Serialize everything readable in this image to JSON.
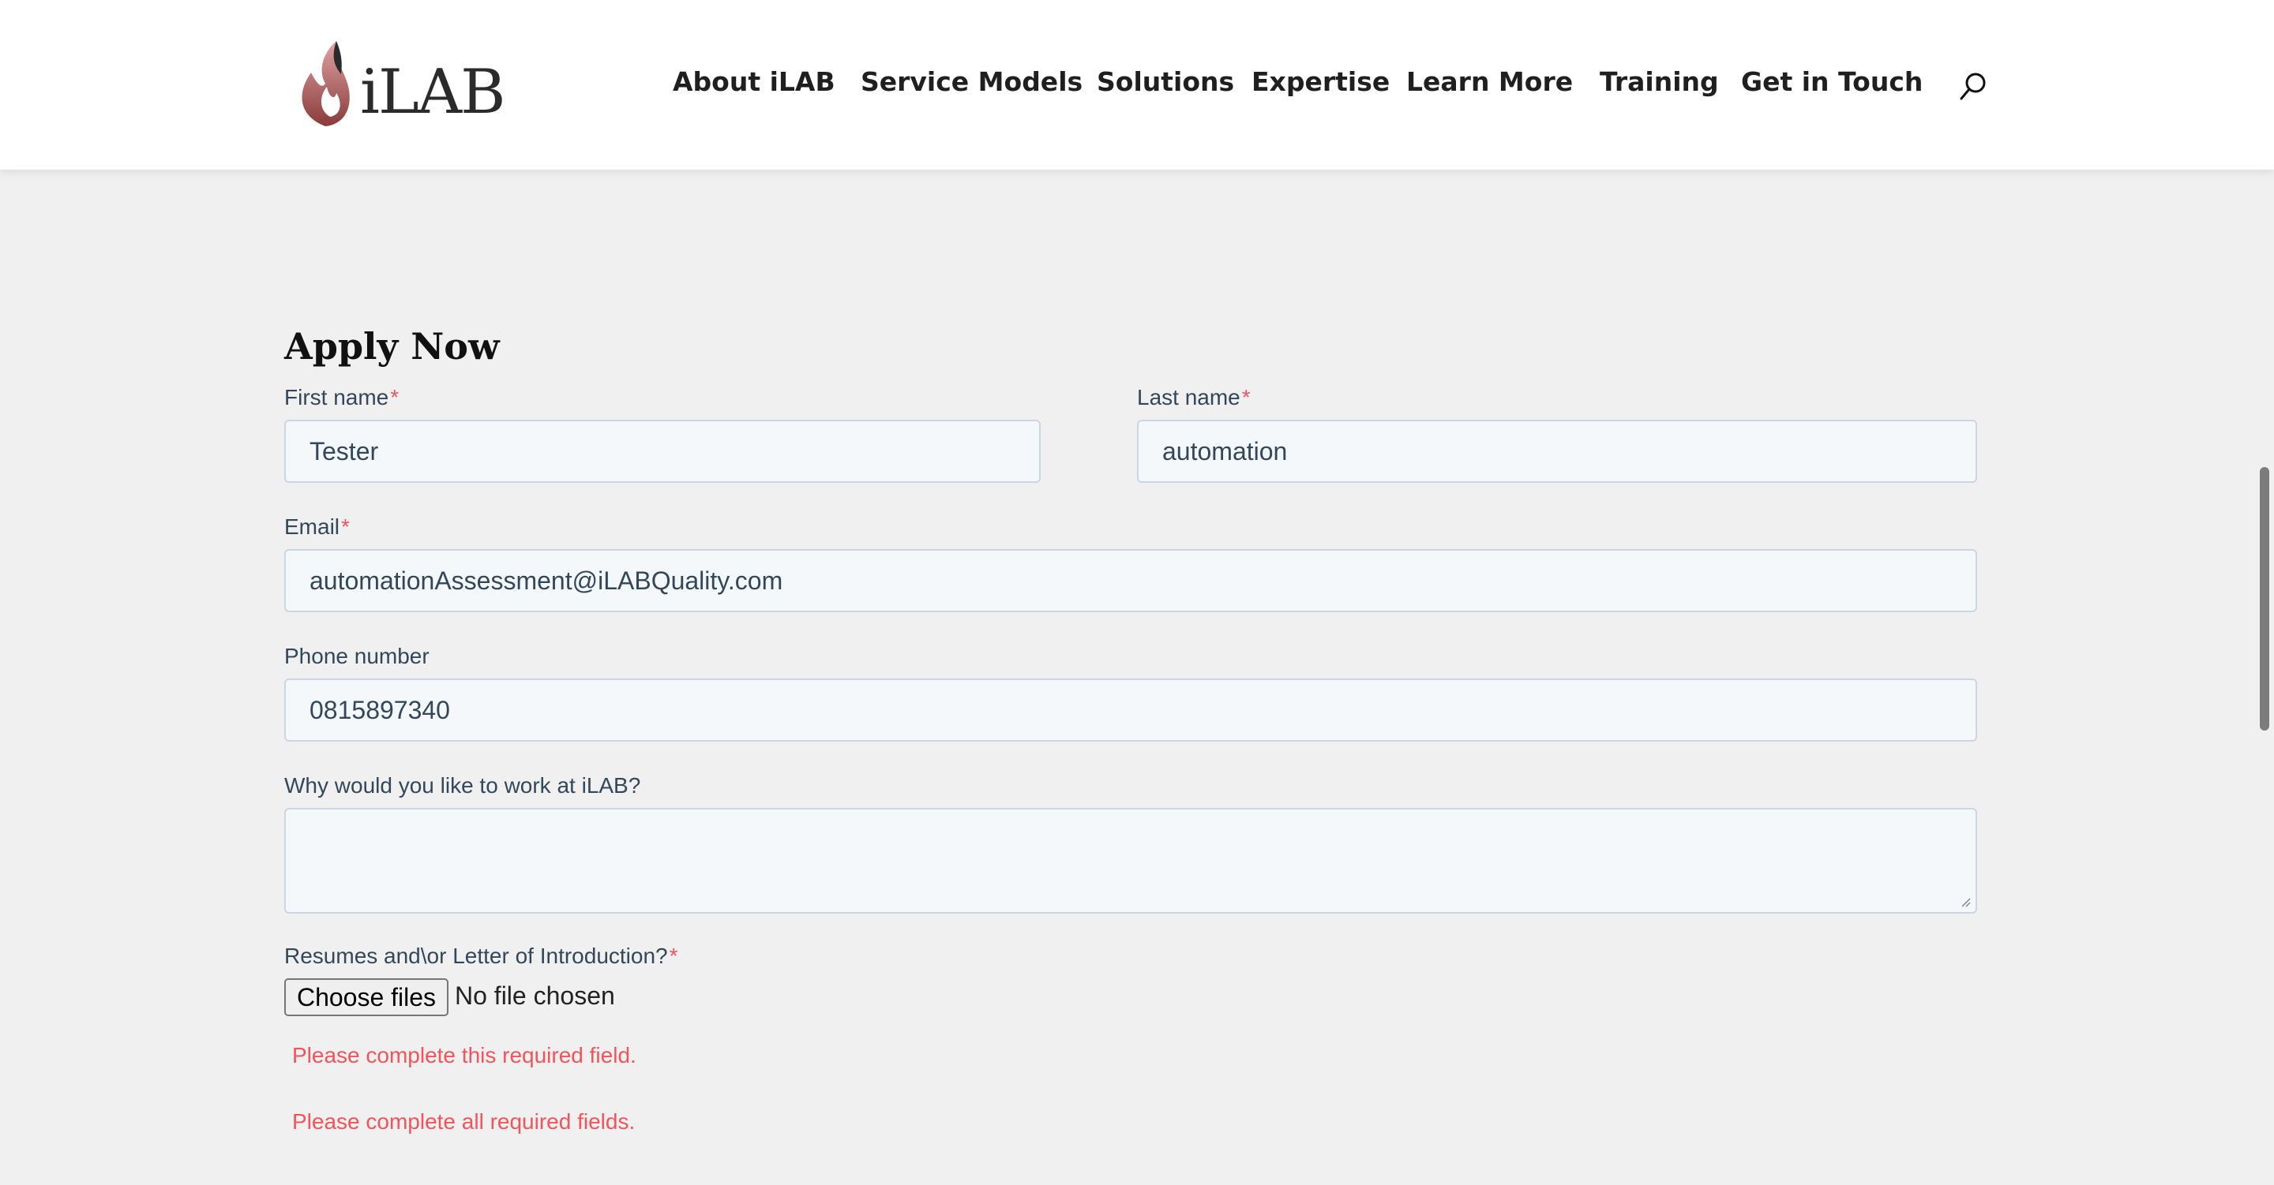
{
  "header": {
    "logo_text": "iLAB",
    "nav": [
      {
        "label": "About iLAB"
      },
      {
        "label": "Service Models"
      },
      {
        "label": "Solutions"
      },
      {
        "label": "Expertise"
      },
      {
        "label": "Learn More"
      },
      {
        "label": "Training"
      },
      {
        "label": "Get in Touch"
      }
    ],
    "search_icon": "search-icon"
  },
  "form": {
    "title": "Apply Now",
    "first_name": {
      "label": "First name",
      "required_mark": "*",
      "value": "Tester"
    },
    "last_name": {
      "label": "Last name",
      "required_mark": "*",
      "value": "automation"
    },
    "email": {
      "label": "Email",
      "required_mark": "*",
      "value": "automationAssessment@iLABQuality.com"
    },
    "phone": {
      "label": "Phone number",
      "value": "0815897340"
    },
    "why": {
      "label": "Why would you like to work at iLAB?",
      "value": ""
    },
    "resume": {
      "label": "Resumes and\\or Letter of Introduction?",
      "required_mark": "*",
      "button_label": "Choose files",
      "status": "No file chosen"
    },
    "errors": {
      "field": "Please complete this required field.",
      "form": "Please complete all required fields."
    }
  },
  "colors": {
    "error": "#f2545b",
    "input_bg": "#f5f8fa",
    "input_border": "#cbd6e2",
    "page_bg": "#f0f0f0"
  }
}
